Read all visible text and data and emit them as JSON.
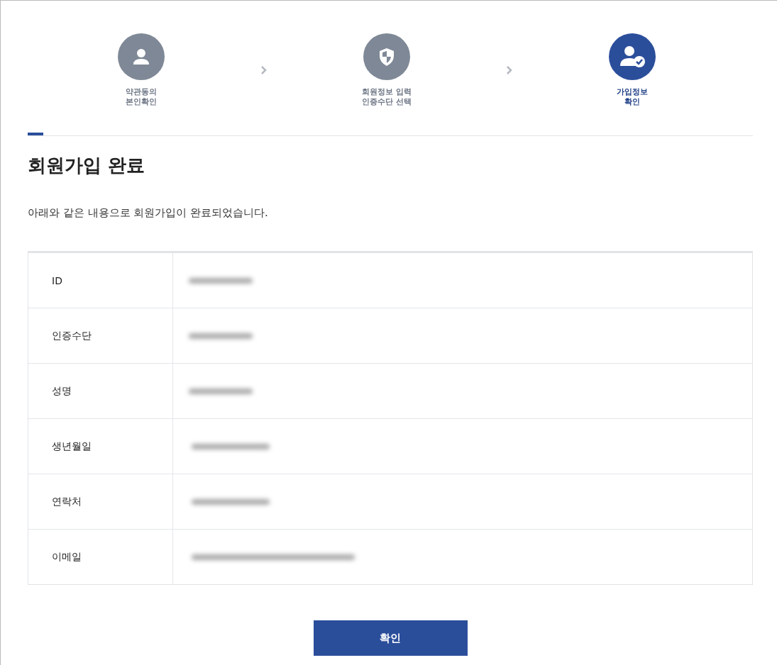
{
  "steps": [
    {
      "kind": "person",
      "lines": [
        "약관동의",
        "본인확인"
      ],
      "selected": false
    },
    {
      "kind": "shield",
      "lines": [
        "회원정보 입력",
        "인증수단 선택"
      ],
      "selected": false
    },
    {
      "kind": "person-check",
      "lines": [
        "가입정보",
        "확인"
      ],
      "selected": true
    }
  ],
  "title": "회원가입 완료",
  "message": "아래와 같은 내용으로 회원가입이 완료되었습니다.",
  "rows": [
    {
      "label": "ID",
      "redacted": true
    },
    {
      "label": "인증수단",
      "redacted": true
    },
    {
      "label": "성명",
      "redacted": true
    },
    {
      "label": "생년월일",
      "redacted": true
    },
    {
      "label": "연락처",
      "redacted": true
    },
    {
      "label": "이메일",
      "redacted": true
    }
  ],
  "confirm_button": "확인"
}
